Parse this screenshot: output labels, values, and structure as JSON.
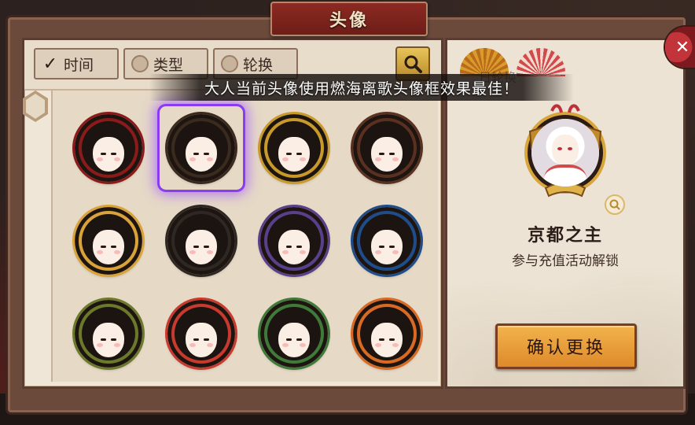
{
  "window": {
    "title": "头像"
  },
  "announcement": "大人当前头像使用燃海离歌头像框效果最佳！",
  "filters": {
    "tabs": [
      {
        "label": "时间",
        "checked": true
      },
      {
        "label": "类型",
        "checked": false
      },
      {
        "label": "轮换",
        "checked": false
      }
    ],
    "search_icon": "search-icon"
  },
  "avatars": [
    {
      "name": "red-torii-frame",
      "color": "#8b1a1a",
      "selected": false
    },
    {
      "name": "golden-helmet-frame",
      "color": "#3b2a1e",
      "selected": true
    },
    {
      "name": "gold-dragon-frame",
      "color": "#c89a2a",
      "selected": false
    },
    {
      "name": "dark-helmet-frame",
      "color": "#5a3020",
      "selected": false
    },
    {
      "name": "autumn-leaf-frame",
      "color": "#d9a33a",
      "selected": false
    },
    {
      "name": "plain-dark-frame",
      "color": "#2e2824",
      "selected": false
    },
    {
      "name": "purple-moon-frame",
      "color": "#5a3f8a",
      "selected": false
    },
    {
      "name": "peacock-frame",
      "color": "#1f4d8a",
      "selected": false
    },
    {
      "name": "pine-rope-frame",
      "color": "#6b7a2a",
      "selected": false
    },
    {
      "name": "lucky-cat-frame",
      "color": "#c83a2e",
      "selected": false
    },
    {
      "name": "snake-rabbit-frame",
      "color": "#3f7a3a",
      "selected": false
    },
    {
      "name": "skull-maple-frame",
      "color": "#d86a24",
      "selected": false
    }
  ],
  "preview": {
    "frame_name": "京都之主",
    "description": "参与充值活动解锁",
    "confirm_label": "确认更换",
    "fan_label": "日轮换"
  },
  "colors": {
    "accent_purple": "#8a3cf0",
    "button_orange": "#e99a36",
    "title_red": "#7c2019"
  }
}
